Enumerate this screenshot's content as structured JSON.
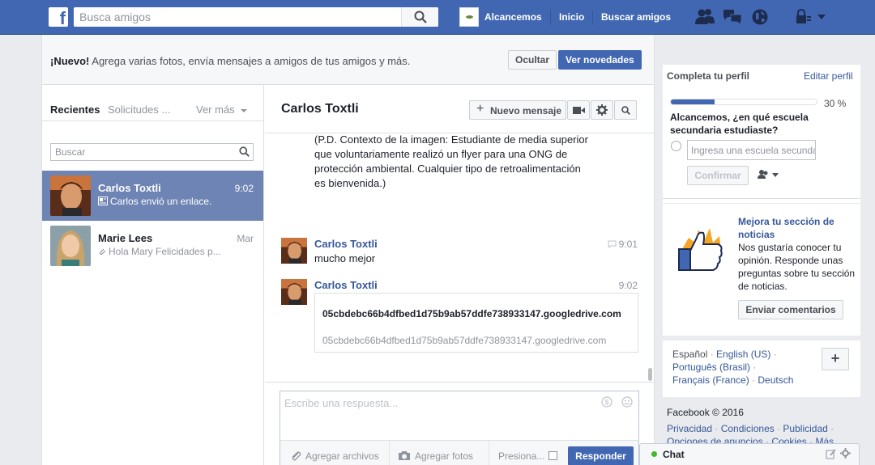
{
  "topbar": {
    "logo_letter": "f",
    "search_placeholder": "Busca amigos",
    "profile_name": "Alcancemos",
    "home_label": "Inicio",
    "find_friends_label": "Buscar amigos",
    "icons": [
      "friend-requests-icon",
      "messages-icon",
      "notifications-globe-icon",
      "privacy-lock-icon",
      "account-dropdown-icon"
    ]
  },
  "promo": {
    "new_label": "¡Nuevo!",
    "text": " Agrega varias fotos, envía mensajes a amigos de tus amigos y más.",
    "hide_label": "Ocultar",
    "see_label": "Ver novedades"
  },
  "list": {
    "tab_recent": "Recientes",
    "tab_requests": "Solicitudes ...",
    "tab_more": "Ver más",
    "search_placeholder": "Buscar",
    "conversations": [
      {
        "name": "Carlos Toxtli",
        "time": "9:02",
        "snippet": "Carlos envió un enlace."
      },
      {
        "name": "Marie Lees",
        "time": "Mar",
        "snippet": "Hola Mary Felicidades p..."
      }
    ]
  },
  "chat": {
    "title": "Carlos Toxtli",
    "new_message_label": "Nuevo mensaje",
    "partial_message": [
      "(P.D. Contexto de la imagen: Estudiante de media superior",
      "que voluntariamente realizó un flyer para una ONG de",
      "protección ambiental. Cualquier tipo de retroalimentación",
      "es bienvenida.)"
    ],
    "messages": [
      {
        "sender": "Carlos Toxtli",
        "time": "9:01",
        "text": "mucho mejor"
      },
      {
        "sender": "Carlos Toxtli",
        "time": "9:02",
        "link_title": "05cbdebc66b4dfbed1d75b9ab57ddfe738933147.googledrive.com",
        "link_url": "05cbdebc66b4dfbed1d75b9ab57ddfe738933147.googledrive.com"
      }
    ],
    "reply_placeholder": "Escribe una respuesta...",
    "attach_files_label": "Agregar archivos",
    "add_photos_label": "Agregar fotos",
    "press_enter_label": "Presiona...",
    "reply_button_label": "Responder"
  },
  "right": {
    "profile_card_title": "Completa tu perfil",
    "edit_profile_label": "Editar perfil",
    "progress_percent_text": "30 %",
    "progress_fraction": 0.3,
    "school_question": "Alcancemos, ¿en qué escuela secundaria estudiaste?",
    "school_placeholder": "Ingresa una escuela secundaria",
    "confirm_label": "Confirmar",
    "feed_title": "Mejora tu sección de noticias",
    "feed_text": "Nos gustaría conocer tu opinión. Responde unas preguntas sobre tu sección de noticias.",
    "send_feedback_label": "Enviar comentarios",
    "languages": [
      "Español",
      "English (US)",
      "Português (Brasil)",
      "Français (France)",
      "Deutsch"
    ],
    "copyright": "Facebook © 2016",
    "footer_links": [
      "Privacidad",
      "Condiciones",
      "Publicidad",
      "Opciones de anuncios",
      "Cookies",
      "Más"
    ]
  },
  "chatbar": {
    "label": "Chat"
  },
  "colors": {
    "brand_blue": "#4267b2",
    "active_row": "#6d84b4",
    "link_blue": "#365899",
    "online_green": "#42b72a"
  }
}
